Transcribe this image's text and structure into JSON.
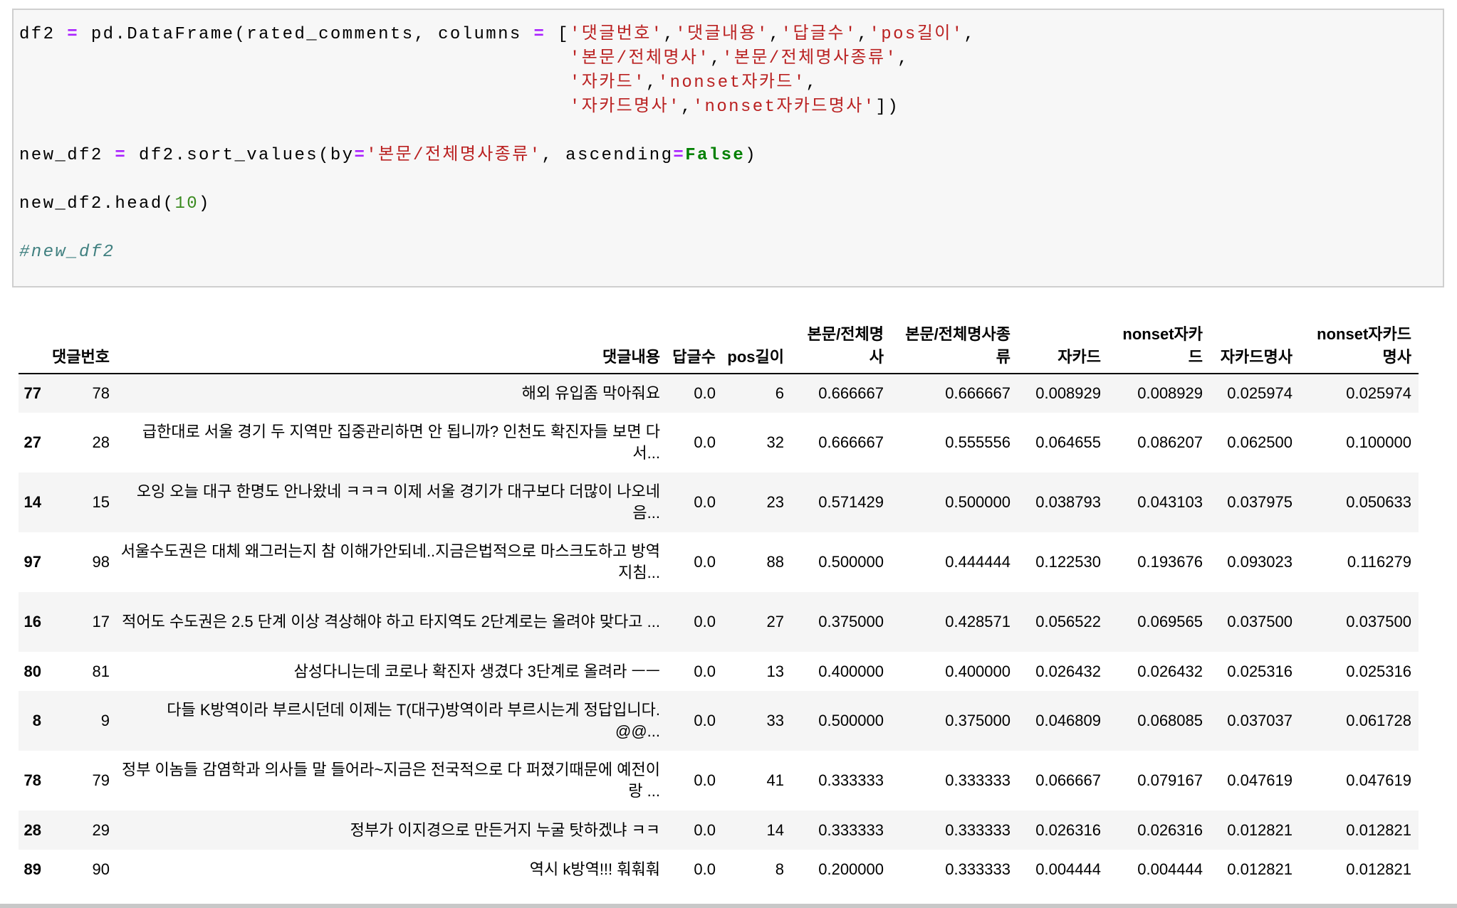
{
  "code_cell": {
    "lines": [
      [
        [
          "n",
          "df2 "
        ],
        [
          "op",
          "="
        ],
        [
          "n",
          " pd.DataFrame(rated_comments, columns "
        ],
        [
          "op",
          "="
        ],
        [
          "n",
          " ["
        ],
        [
          "str",
          "'댓글번호'"
        ],
        [
          "n",
          ","
        ],
        [
          "str",
          "'댓글내용'"
        ],
        [
          "n",
          ","
        ],
        [
          "str",
          "'답글수'"
        ],
        [
          "n",
          ","
        ],
        [
          "str",
          "'pos길이'"
        ],
        [
          "n",
          ","
        ]
      ],
      [
        [
          "n",
          "                                              "
        ],
        [
          "str",
          "'본문/전체명사'"
        ],
        [
          "n",
          ","
        ],
        [
          "str",
          "'본문/전체명사종류'"
        ],
        [
          "n",
          ","
        ]
      ],
      [
        [
          "n",
          "                                              "
        ],
        [
          "str",
          "'자카드'"
        ],
        [
          "n",
          ","
        ],
        [
          "str",
          "'nonset자카드'"
        ],
        [
          "n",
          ","
        ]
      ],
      [
        [
          "n",
          "                                              "
        ],
        [
          "str",
          "'자카드명사'"
        ],
        [
          "n",
          ","
        ],
        [
          "str",
          "'nonset자카드명사'"
        ],
        [
          "n",
          "])"
        ]
      ],
      [
        [
          "n",
          ""
        ]
      ],
      [
        [
          "n",
          "new_df2 "
        ],
        [
          "op",
          "="
        ],
        [
          "n",
          " df2.sort_values(by"
        ],
        [
          "op",
          "="
        ],
        [
          "str",
          "'본문/전체명사종류'"
        ],
        [
          "n",
          ", ascending"
        ],
        [
          "op",
          "="
        ],
        [
          "kw",
          "False"
        ],
        [
          "n",
          ")"
        ]
      ],
      [
        [
          "n",
          ""
        ]
      ],
      [
        [
          "n",
          "new_df2.head("
        ],
        [
          "num",
          "10"
        ],
        [
          "n",
          ")"
        ]
      ],
      [
        [
          "n",
          ""
        ]
      ],
      [
        [
          "cm",
          "#new_df2"
        ]
      ]
    ]
  },
  "table": {
    "columns": [
      "",
      "댓글번호",
      "댓글내용",
      "답글수",
      "pos길이",
      "본문/전체명사",
      "본문/전체명사종류",
      "자카드",
      "nonset자카드",
      "자카드명사",
      "nonset자카드명사"
    ],
    "rows": [
      [
        "77",
        "78",
        "해외 유입좀 막아줘요",
        "0.0",
        "6",
        "0.666667",
        "0.666667",
        "0.008929",
        "0.008929",
        "0.025974",
        "0.025974"
      ],
      [
        "27",
        "28",
        "급한대로 서울 경기 두 지역만 집중관리하면 안 됩니까? 인천도 확진자들 보면 다 서...",
        "0.0",
        "32",
        "0.666667",
        "0.555556",
        "0.064655",
        "0.086207",
        "0.062500",
        "0.100000"
      ],
      [
        "14",
        "15",
        "오잉 오늘 대구 한명도 안나왔네 ㅋㅋㅋ 이제 서울 경기가 대구보다 더많이 나오네 음...",
        "0.0",
        "23",
        "0.571429",
        "0.500000",
        "0.038793",
        "0.043103",
        "0.037975",
        "0.050633"
      ],
      [
        "97",
        "98",
        "서울수도권은 대체 왜그러는지 참 이해가안되네..지금은법적으로 마스크도하고 방역지침...",
        "0.0",
        "88",
        "0.500000",
        "0.444444",
        "0.122530",
        "0.193676",
        "0.093023",
        "0.116279"
      ],
      [
        "16",
        "17",
        "적어도 수도권은 2.5 단계 이상 격상해야 하고 타지역도 2단계로는 올려야 맞다고 ...",
        "0.0",
        "27",
        "0.375000",
        "0.428571",
        "0.056522",
        "0.069565",
        "0.037500",
        "0.037500"
      ],
      [
        "80",
        "81",
        "삼성다니는데 코로나 확진자 생겼다 3단계로 올려라 ㅡㅡ",
        "0.0",
        "13",
        "0.400000",
        "0.400000",
        "0.026432",
        "0.026432",
        "0.025316",
        "0.025316"
      ],
      [
        "8",
        "9",
        "다들 K방역이라 부르시던데 이제는 T(대구)방역이라 부르시는게 정답입니다. @@...",
        "0.0",
        "33",
        "0.500000",
        "0.375000",
        "0.046809",
        "0.068085",
        "0.037037",
        "0.061728"
      ],
      [
        "78",
        "79",
        "정부 이놈들 감염학과 의사들 말 들어라~지금은 전국적으로 다 퍼졌기때문에 예전이랑 ...",
        "0.0",
        "41",
        "0.333333",
        "0.333333",
        "0.066667",
        "0.079167",
        "0.047619",
        "0.047619"
      ],
      [
        "28",
        "29",
        "정부가 이지경으로 만든거지 누굴 탓하겠냐 ㅋㅋ",
        "0.0",
        "14",
        "0.333333",
        "0.333333",
        "0.026316",
        "0.026316",
        "0.012821",
        "0.012821"
      ],
      [
        "89",
        "90",
        "역시 k방역!!! 훠훠훠",
        "0.0",
        "8",
        "0.200000",
        "0.333333",
        "0.004444",
        "0.004444",
        "0.012821",
        "0.012821"
      ]
    ]
  }
}
